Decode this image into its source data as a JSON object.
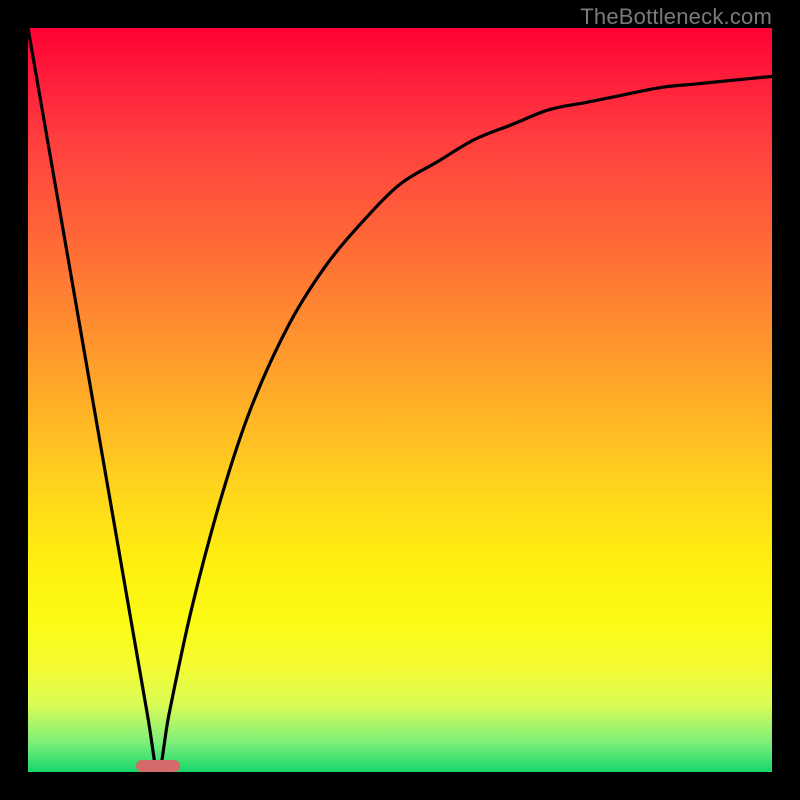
{
  "watermark": "TheBottleneck.com",
  "colors": {
    "page_bg": "#000000",
    "gradient_top": "#ff0033",
    "gradient_bottom": "#17d66b",
    "curve": "#000000",
    "min_marker": "#d46a6a",
    "watermark_text": "#7a7a7a"
  },
  "chart_data": {
    "type": "line",
    "title": "",
    "xlabel": "",
    "ylabel": "",
    "xlim": [
      0,
      1
    ],
    "ylim": [
      0,
      1
    ],
    "series": [
      {
        "name": "bottleneck-curve",
        "x": [
          0.0,
          0.04,
          0.08,
          0.12,
          0.16,
          0.175,
          0.19,
          0.22,
          0.26,
          0.3,
          0.35,
          0.4,
          0.45,
          0.5,
          0.55,
          0.6,
          0.65,
          0.7,
          0.75,
          0.8,
          0.85,
          0.9,
          0.95,
          1.0
        ],
        "y": [
          1.0,
          0.77,
          0.54,
          0.31,
          0.08,
          0.0,
          0.08,
          0.22,
          0.37,
          0.49,
          0.6,
          0.68,
          0.74,
          0.79,
          0.82,
          0.85,
          0.87,
          0.89,
          0.9,
          0.91,
          0.92,
          0.925,
          0.93,
          0.935
        ]
      }
    ],
    "min_point": {
      "x": 0.175,
      "y": 0.0
    }
  }
}
